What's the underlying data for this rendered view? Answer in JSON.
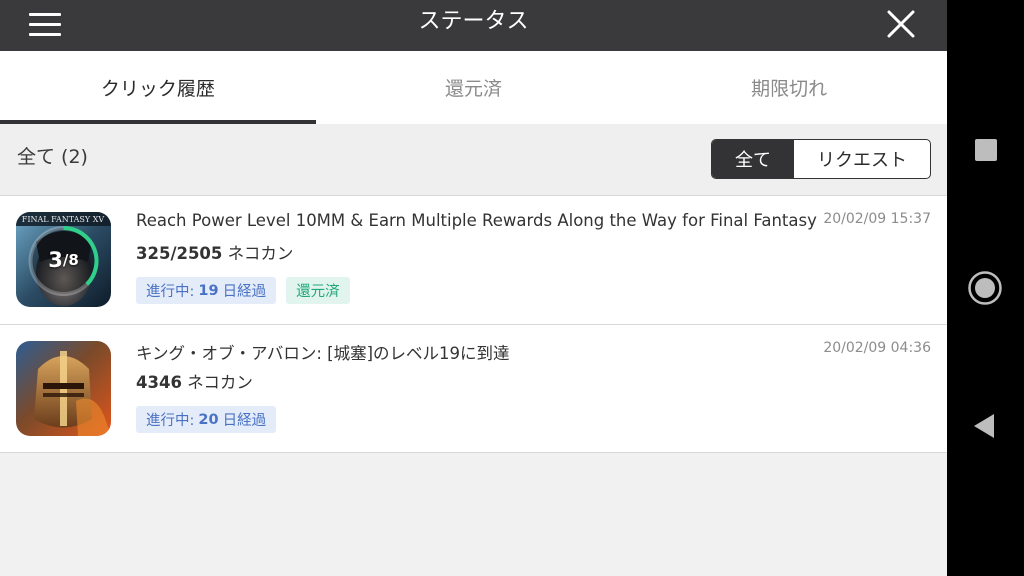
{
  "header": {
    "title": "ステータス"
  },
  "tabs": [
    {
      "label": "クリック履歴",
      "active": true
    },
    {
      "label": "還元済",
      "active": false
    },
    {
      "label": "期限切れ",
      "active": false
    }
  ],
  "filter": {
    "count_label": "全て (2)",
    "segments": [
      "全て",
      "リクエスト"
    ],
    "selected": "全て"
  },
  "items": [
    {
      "title": "Reach Power Level 10MM & Earn Multiple Rewards Along the Way for Final Fantasy",
      "points_value": "325/2505",
      "points_unit": " ネコカン",
      "timestamp": "20/02/09 15:37",
      "thumb_text": "FINAL FANTASY XV",
      "progress_current": "3",
      "progress_sep": "/",
      "progress_total": "8",
      "progress_fraction": 0.375,
      "status_prefix": "進行中:",
      "status_days": "19",
      "status_suffix": "日経過",
      "extra_badge": "還元済"
    },
    {
      "title": "キング・オブ・アバロン: [城塞]のレベル19に到達",
      "points_value": "4346",
      "points_unit": " ネコカン",
      "timestamp": "20/02/09 04:36",
      "status_prefix": "進行中:",
      "status_days": "20",
      "status_suffix": "日経過"
    }
  ],
  "colors": {
    "header_bg": "#3a3a3d",
    "progress_ring": "#2fd08a",
    "badge_progress_text": "#4a72c4",
    "badge_returned_text": "#22a77a"
  },
  "icons": {
    "menu": "hamburger-icon",
    "close": "close-icon",
    "nav_recents": "square-icon",
    "nav_home": "circle-icon",
    "nav_back": "triangle-back-icon"
  }
}
